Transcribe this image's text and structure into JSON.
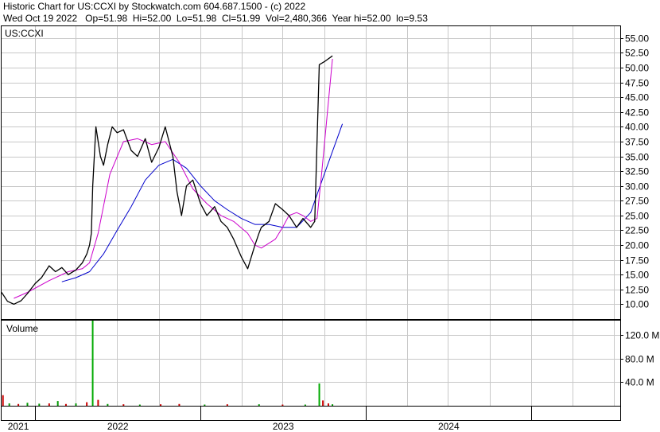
{
  "header": {
    "line1": "Historic Chart for US:CCXI by Stockwatch.com 604.687.1500 - (c) 2022",
    "line2": "Wed Oct 19 2022   Op=51.98  Hi=52.00  Lo=51.98  Cl=51.99  Vol=2,480,366  Year hi=52.00  lo=9.53"
  },
  "colors": {
    "price": "#000000",
    "ma_short": "#cc00cc",
    "ma_long": "#0000cc",
    "volume_up": "#009900",
    "volume_down": "#cc0000",
    "volume_spike": "#00aa00",
    "grid": "#c8c8c8"
  },
  "chart_data": [
    {
      "type": "line",
      "panel": "price",
      "title": "US:CCXI",
      "ylim": [
        7.5,
        57
      ],
      "yticks": [
        10.0,
        12.5,
        15.0,
        17.5,
        20.0,
        22.5,
        25.0,
        27.5,
        30.0,
        32.5,
        35.0,
        37.5,
        40.0,
        42.5,
        45.0,
        47.5,
        50.0,
        52.5,
        55.0
      ],
      "ytick_labels": [
        "10.00",
        "12.50",
        "15.00",
        "17.50",
        "20.00",
        "22.50",
        "25.00",
        "27.50",
        "30.00",
        "32.50",
        "35.00",
        "37.50",
        "40.00",
        "42.50",
        "45.00",
        "47.50",
        "50.00",
        "52.50",
        "55.00"
      ],
      "xlim": [
        "2020-10-19",
        "2024-07-15"
      ],
      "x_axis_labels": [
        "2021",
        "2022",
        "2023",
        "2024"
      ],
      "x_axis_dividers": [
        "2021-01-01",
        "2022-01-01",
        "2023-01-01",
        "2024-01-01"
      ],
      "grid": true,
      "series": [
        {
          "role": "price",
          "x": [
            "2020-10-19",
            "2020-11-01",
            "2020-11-15",
            "2020-12-01",
            "2020-12-15",
            "2021-01-01",
            "2021-01-15",
            "2021-02-01",
            "2021-02-15",
            "2021-03-01",
            "2021-03-15",
            "2021-04-01",
            "2021-04-15",
            "2021-04-25",
            "2021-05-01",
            "2021-05-05",
            "2021-05-08",
            "2021-05-15",
            "2021-05-25",
            "2021-06-01",
            "2021-06-10",
            "2021-06-20",
            "2021-07-01",
            "2021-07-15",
            "2021-08-01",
            "2021-08-15",
            "2021-09-01",
            "2021-09-15",
            "2021-10-01",
            "2021-10-15",
            "2021-11-01",
            "2021-11-10",
            "2021-11-20",
            "2021-12-01",
            "2021-12-15",
            "2022-01-01",
            "2022-01-15",
            "2022-02-01",
            "2022-02-15",
            "2022-03-01",
            "2022-03-15",
            "2022-04-01",
            "2022-04-15",
            "2022-05-01",
            "2022-05-10",
            "2022-05-15",
            "2022-06-01",
            "2022-06-15",
            "2022-07-01",
            "2022-07-15",
            "2022-08-01",
            "2022-08-15",
            "2022-09-01",
            "2022-09-10",
            "2022-09-20",
            "2022-10-01",
            "2022-10-19"
          ],
          "values": [
            12.0,
            10.5,
            10.0,
            10.6,
            11.8,
            13.5,
            14.5,
            16.5,
            15.5,
            16.2,
            15.0,
            15.8,
            17.0,
            18.5,
            20.0,
            22.0,
            30.0,
            40.0,
            35.0,
            33.5,
            37.0,
            40.0,
            39.0,
            39.5,
            36.0,
            35.0,
            38.0,
            34.0,
            36.5,
            40.0,
            35.0,
            29.0,
            25.0,
            30.0,
            31.0,
            27.0,
            25.0,
            26.5,
            24.0,
            23.0,
            21.0,
            18.0,
            16.0,
            20.0,
            22.0,
            23.0,
            24.0,
            27.0,
            26.0,
            25.0,
            23.0,
            24.5,
            23.0,
            24.0,
            50.5,
            51.0,
            51.99
          ]
        },
        {
          "role": "ma_short",
          "x": [
            "2020-11-15",
            "2020-12-15",
            "2021-02-01",
            "2021-03-15",
            "2021-04-15",
            "2021-05-01",
            "2021-05-20",
            "2021-06-15",
            "2021-07-15",
            "2021-08-15",
            "2021-09-15",
            "2021-10-15",
            "2021-11-15",
            "2021-12-15",
            "2022-01-15",
            "2022-02-15",
            "2022-03-15",
            "2022-04-15",
            "2022-05-01",
            "2022-05-15",
            "2022-06-15",
            "2022-07-01",
            "2022-07-15",
            "2022-08-01",
            "2022-08-15",
            "2022-09-01",
            "2022-09-15",
            "2022-09-25",
            "2022-10-19"
          ],
          "values": [
            11.0,
            12.0,
            14.0,
            15.5,
            16.0,
            17.0,
            22.0,
            32.0,
            37.5,
            38.0,
            37.0,
            37.5,
            34.0,
            29.5,
            27.0,
            25.0,
            24.0,
            22.0,
            20.0,
            19.5,
            21.0,
            23.0,
            25.0,
            25.5,
            25.0,
            24.0,
            24.5,
            32.0,
            51.5
          ]
        },
        {
          "role": "ma_long",
          "x": [
            "2021-03-01",
            "2021-04-01",
            "2021-05-01",
            "2021-06-01",
            "2021-07-01",
            "2021-08-01",
            "2021-09-01",
            "2021-10-01",
            "2021-11-01",
            "2021-12-01",
            "2022-01-01",
            "2022-02-01",
            "2022-03-01",
            "2022-04-01",
            "2022-05-01",
            "2022-06-01",
            "2022-07-01",
            "2022-08-01",
            "2022-09-01",
            "2022-10-01",
            "2022-11-10"
          ],
          "values": [
            13.8,
            14.5,
            15.5,
            18.5,
            22.5,
            26.5,
            31.0,
            33.5,
            34.5,
            33.0,
            30.0,
            27.5,
            26.0,
            24.5,
            23.5,
            23.5,
            23.0,
            23.0,
            25.5,
            32.0,
            40.5
          ]
        }
      ]
    },
    {
      "type": "bar",
      "panel": "volume",
      "title": "Volume",
      "ylim": [
        0,
        145
      ],
      "yticks": [
        40.0,
        80.0,
        120.0
      ],
      "ytick_labels": [
        "40.0 M",
        "80.0 M",
        "120.0 M"
      ],
      "grid": true,
      "bars": [
        {
          "x": "2020-10-22",
          "value": 18.0,
          "dir": "down"
        },
        {
          "x": "2020-11-05",
          "value": 4.0,
          "dir": "up"
        },
        {
          "x": "2020-11-25",
          "value": 3.0,
          "dir": "down"
        },
        {
          "x": "2020-12-15",
          "value": 5.0,
          "dir": "up"
        },
        {
          "x": "2021-01-10",
          "value": 3.5,
          "dir": "up"
        },
        {
          "x": "2021-02-01",
          "value": 4.0,
          "dir": "down"
        },
        {
          "x": "2021-02-20",
          "value": 8.0,
          "dir": "up"
        },
        {
          "x": "2021-03-10",
          "value": 3.0,
          "dir": "down"
        },
        {
          "x": "2021-04-01",
          "value": 4.0,
          "dir": "up"
        },
        {
          "x": "2021-04-25",
          "value": 6.0,
          "dir": "down"
        },
        {
          "x": "2021-05-08",
          "value": 145.0,
          "dir": "spike"
        },
        {
          "x": "2021-05-20",
          "value": 10.0,
          "dir": "down"
        },
        {
          "x": "2021-06-10",
          "value": 3.0,
          "dir": "up"
        },
        {
          "x": "2021-07-15",
          "value": 2.5,
          "dir": "down"
        },
        {
          "x": "2021-08-20",
          "value": 2.0,
          "dir": "up"
        },
        {
          "x": "2021-10-05",
          "value": 2.5,
          "dir": "down"
        },
        {
          "x": "2021-11-15",
          "value": 3.0,
          "dir": "down"
        },
        {
          "x": "2022-01-10",
          "value": 2.0,
          "dir": "up"
        },
        {
          "x": "2022-03-01",
          "value": 2.5,
          "dir": "down"
        },
        {
          "x": "2022-05-10",
          "value": 2.5,
          "dir": "up"
        },
        {
          "x": "2022-07-01",
          "value": 2.0,
          "dir": "down"
        },
        {
          "x": "2022-08-20",
          "value": 2.0,
          "dir": "up"
        },
        {
          "x": "2022-09-20",
          "value": 38.0,
          "dir": "spike"
        },
        {
          "x": "2022-09-28",
          "value": 9.0,
          "dir": "down"
        },
        {
          "x": "2022-10-10",
          "value": 4.0,
          "dir": "down"
        },
        {
          "x": "2022-10-19",
          "value": 2.5,
          "dir": "up"
        }
      ]
    }
  ]
}
